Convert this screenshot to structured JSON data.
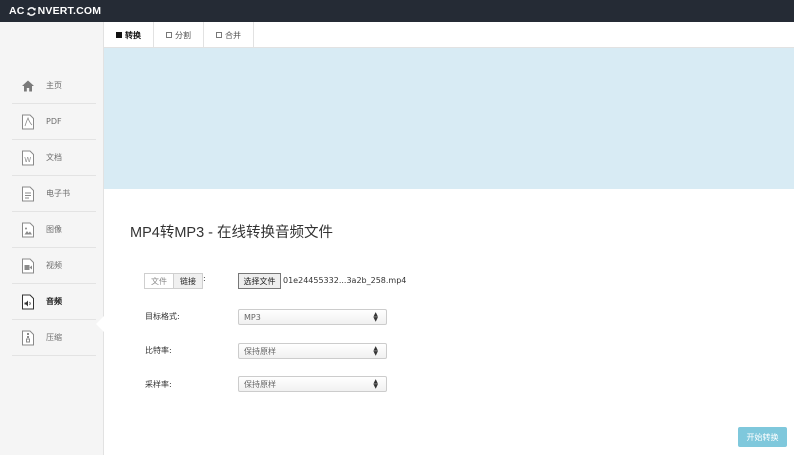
{
  "header": {
    "logo_left": "AC",
    "logo_right": "NVERT.COM",
    "logo_icon": "refresh-icon"
  },
  "sidebar": {
    "items": [
      {
        "label": "主页",
        "icon": "home-icon",
        "active": false
      },
      {
        "label": "PDF",
        "icon": "pdf-file-icon",
        "active": false
      },
      {
        "label": "文档",
        "icon": "word-file-icon",
        "active": false
      },
      {
        "label": "电子书",
        "icon": "ebook-icon",
        "active": false
      },
      {
        "label": "图像",
        "icon": "image-icon",
        "active": false
      },
      {
        "label": "视频",
        "icon": "video-icon",
        "active": false
      },
      {
        "label": "音频",
        "icon": "audio-icon",
        "active": true
      },
      {
        "label": "压缩",
        "icon": "archive-icon",
        "active": false
      }
    ]
  },
  "tabs": [
    {
      "label": "转换",
      "active": true
    },
    {
      "label": "分割",
      "active": false
    },
    {
      "label": "合并",
      "active": false
    }
  ],
  "main": {
    "title": "MP4转MP3 - 在线转换音频文件",
    "source_toggle": {
      "file": "文件",
      "link": "链接",
      "colon": ":"
    },
    "file_button": "选择文件",
    "file_name": "01e24455332...3a2b_258.mp4",
    "fields": [
      {
        "label": "目标格式:",
        "value": "MP3"
      },
      {
        "label": "比特率:",
        "value": "保持原样"
      },
      {
        "label": "采样率:",
        "value": "保持原样"
      }
    ],
    "start_button": "开始转换"
  },
  "colors": {
    "topbar": "#252b35",
    "banner": "#d8ebf4",
    "start_button": "#7fc8dc",
    "sidebar_bg": "#f5f5f5"
  }
}
